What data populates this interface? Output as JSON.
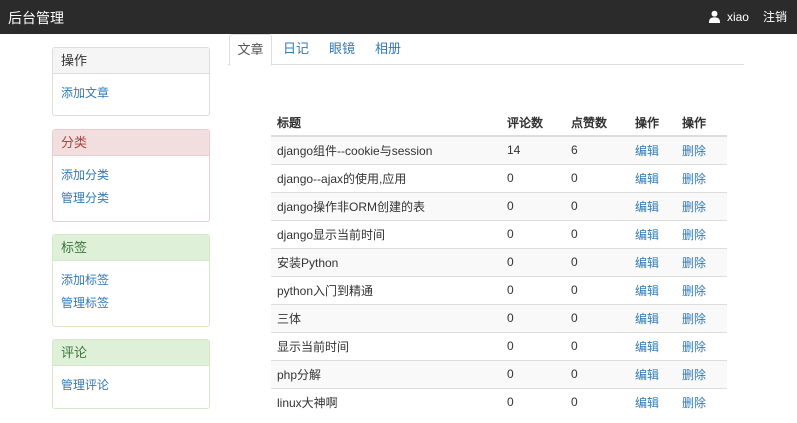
{
  "navbar": {
    "brand": "后台管理",
    "username": "xiao",
    "logout": "注销"
  },
  "sidebar": {
    "panels": [
      {
        "title": "操作",
        "links": [
          "添加文章"
        ]
      },
      {
        "title": "分类",
        "links": [
          "添加分类",
          "管理分类"
        ]
      },
      {
        "title": "标签",
        "links": [
          "添加标签",
          "管理标签"
        ]
      },
      {
        "title": "评论",
        "links": [
          "管理评论"
        ]
      }
    ]
  },
  "tabs": [
    "文章",
    "日记",
    "眼镜",
    "相册"
  ],
  "table": {
    "headers": [
      "标题",
      "评论数",
      "点赞数",
      "操作",
      "操作"
    ],
    "rows": [
      {
        "title": "django组件--cookie与session",
        "comments": "14",
        "likes": "6",
        "edit": "编辑",
        "delete": "删除"
      },
      {
        "title": "django--ajax的使用,应用",
        "comments": "0",
        "likes": "0",
        "edit": "编辑",
        "delete": "删除"
      },
      {
        "title": "django操作非ORM创建的表",
        "comments": "0",
        "likes": "0",
        "edit": "编辑",
        "delete": "删除"
      },
      {
        "title": "django显示当前时间",
        "comments": "0",
        "likes": "0",
        "edit": "编辑",
        "delete": "删除"
      },
      {
        "title": "安装Python",
        "comments": "0",
        "likes": "0",
        "edit": "编辑",
        "delete": "删除"
      },
      {
        "title": "python入门到精通",
        "comments": "0",
        "likes": "0",
        "edit": "编辑",
        "delete": "删除"
      },
      {
        "title": "三体",
        "comments": "0",
        "likes": "0",
        "edit": "编辑",
        "delete": "删除"
      },
      {
        "title": "显示当前时间",
        "comments": "0",
        "likes": "0",
        "edit": "编辑",
        "delete": "删除"
      },
      {
        "title": "php分解",
        "comments": "0",
        "likes": "0",
        "edit": "编辑",
        "delete": "删除"
      },
      {
        "title": "linux大神啊",
        "comments": "0",
        "likes": "0",
        "edit": "编辑",
        "delete": "删除"
      }
    ]
  }
}
